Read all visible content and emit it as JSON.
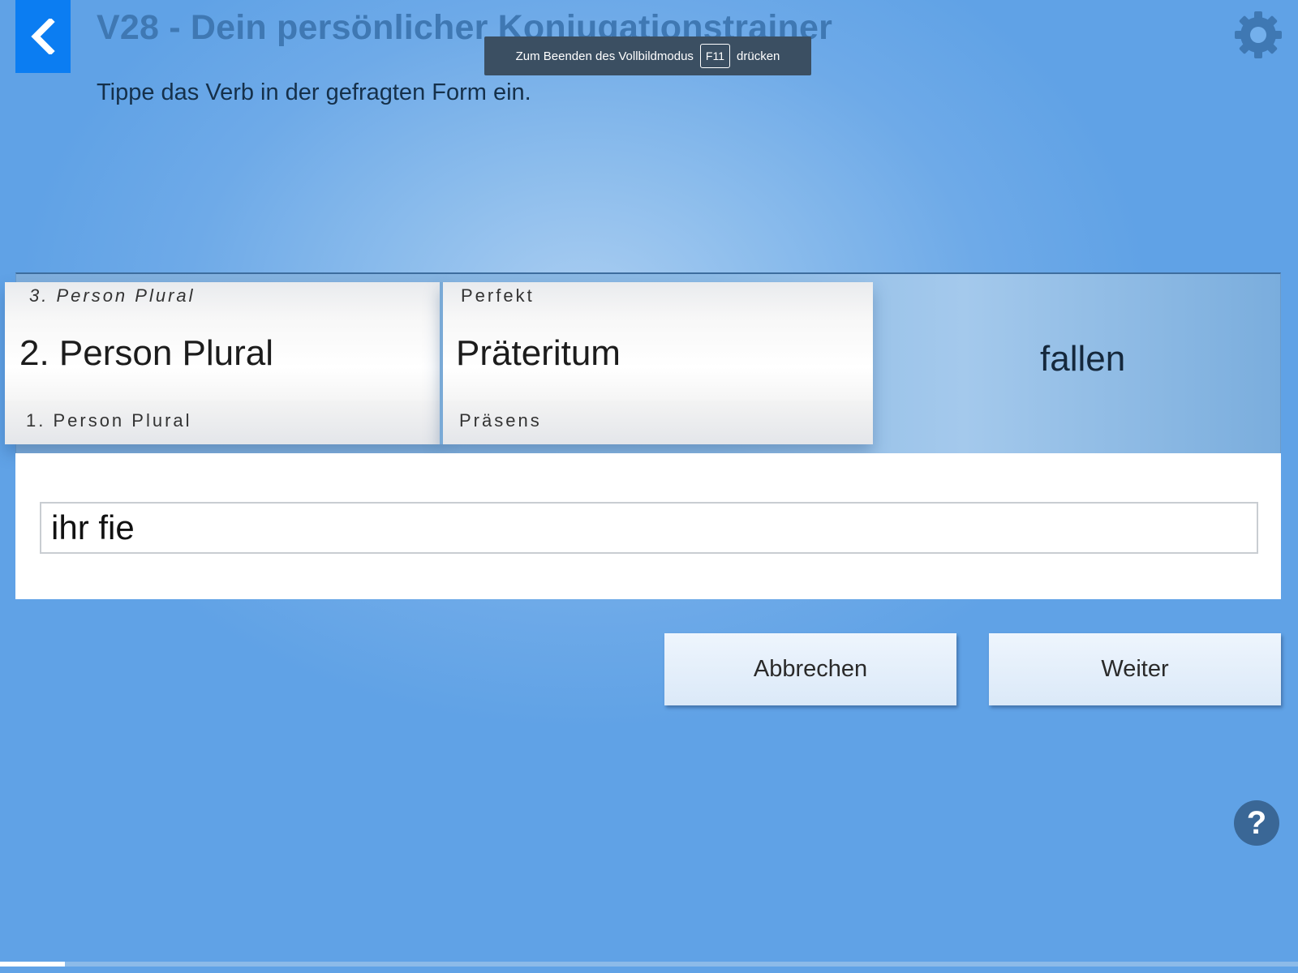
{
  "header": {
    "title": "V28 - Dein persönlicher Konjugationstrainer",
    "subtitle": "Tippe das Verb in der gefragten Form ein.",
    "back_icon": "chevron-left-icon",
    "settings_icon": "gear-icon"
  },
  "fullscreen_notice": {
    "text_before": "Zum Beenden des Vollbildmodus",
    "key": "F11",
    "text_after": "drücken"
  },
  "selector": {
    "person": {
      "previous": "3. Person Plural",
      "selected": "2. Person Plural",
      "next": "1. Person Plural"
    },
    "tense": {
      "previous": "Perfekt",
      "selected": "Präteritum",
      "next": "Präsens"
    },
    "verb": "fallen"
  },
  "answer": {
    "value": "ihr fie"
  },
  "actions": {
    "cancel_label": "Abbrechen",
    "next_label": "Weiter"
  },
  "help": {
    "icon": "question-icon",
    "symbol": "?"
  },
  "progress": {
    "fraction": 0.05
  },
  "colors": {
    "accent": "#0b7df2",
    "title": "#3f78b3",
    "background": "#6eaae8"
  }
}
